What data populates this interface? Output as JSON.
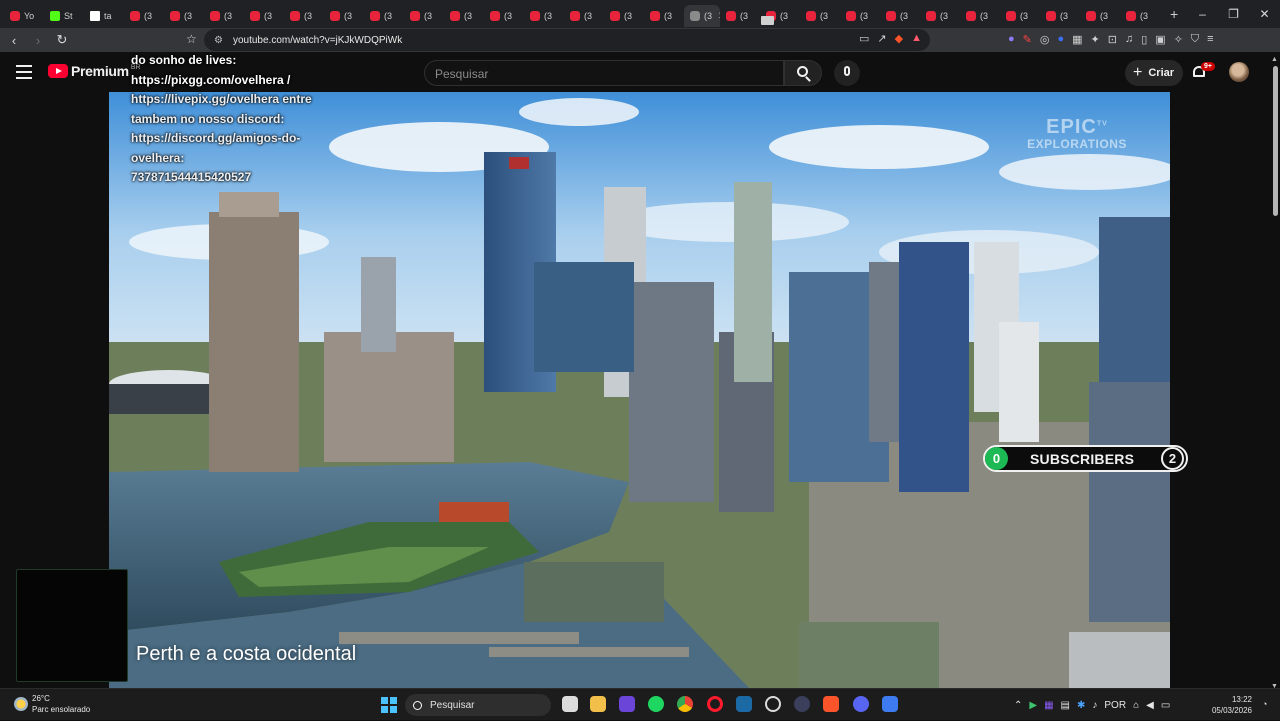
{
  "browser": {
    "tabs": [
      {
        "label": "Yo",
        "favicon": "youtube-icon"
      },
      {
        "label": "St",
        "favicon": "kick-icon"
      },
      {
        "label": "ta",
        "favicon": "gmail-icon"
      },
      {
        "label": "(3",
        "favicon": "youtube-icon"
      },
      {
        "label": "(3",
        "favicon": "youtube-icon"
      },
      {
        "label": "(3",
        "favicon": "youtube-icon"
      },
      {
        "label": "(3",
        "favicon": "youtube-icon"
      },
      {
        "label": "(3",
        "favicon": "youtube-icon"
      },
      {
        "label": "(3",
        "favicon": "youtube-icon"
      },
      {
        "label": "(3",
        "favicon": "youtube-icon"
      },
      {
        "label": "(3",
        "favicon": "youtube-icon"
      },
      {
        "label": "(3",
        "favicon": "youtube-icon"
      },
      {
        "label": "(3",
        "favicon": "youtube-icon"
      },
      {
        "label": "(3",
        "favicon": "youtube-icon"
      },
      {
        "label": "(3",
        "favicon": "youtube-icon"
      },
      {
        "label": "(3",
        "favicon": "youtube-icon"
      },
      {
        "label": "(3",
        "favicon": "youtube-icon"
      },
      {
        "label": "(3",
        "favicon": "gray-icon",
        "active": true
      },
      {
        "label": "(3",
        "favicon": "youtube-icon"
      },
      {
        "label": "(3",
        "favicon": "youtube-icon"
      },
      {
        "label": "(3",
        "favicon": "youtube-icon"
      },
      {
        "label": "(3",
        "favicon": "youtube-icon"
      },
      {
        "label": "(3",
        "favicon": "youtube-icon"
      },
      {
        "label": "(3",
        "favicon": "youtube-icon"
      },
      {
        "label": "(3",
        "favicon": "youtube-icon"
      },
      {
        "label": "(3",
        "favicon": "youtube-icon"
      },
      {
        "label": "(3",
        "favicon": "youtube-icon"
      },
      {
        "label": "(3",
        "favicon": "youtube-icon"
      },
      {
        "label": "(3",
        "favicon": "youtube-icon"
      }
    ],
    "new_tab": "+",
    "url": "youtube.com/watch?v=jKJkWDQPiWk",
    "win_controls": [
      "–",
      "❐",
      "✕"
    ]
  },
  "youtube": {
    "logo_text": "Premium",
    "logo_country": "BR",
    "search_placeholder": "Pesquisar",
    "create_label": "Criar",
    "notification_count": "9+"
  },
  "video": {
    "chat_overlay": [
      "do sonho de lives:",
      "https://pixgg.com/ovelhera /",
      "https://livepix.gg/ovelhera entre",
      "tambem no nosso discord:",
      "https://discord.gg/amigos-do-",
      "ovelhera:",
      "737871544415420527"
    ],
    "watermark_line1": "EPIC",
    "watermark_tv": "TV",
    "watermark_line2": "EXPLORATIONS",
    "subscribers_left": "0",
    "subscribers_label": "SUBSCRIBERS",
    "subscribers_right": "2",
    "caption": "Perth e a costa ocidental"
  },
  "taskbar": {
    "temperature": "26°C",
    "weather_desc": "Parc ensolarado",
    "search_label": "Pesquisar",
    "language": "POR",
    "time": "13:22",
    "date": "05/03/2026"
  },
  "colors": {
    "youtube_red": "#ff0033",
    "subscriber_green": "#1db954",
    "windows_blue": "#4cc2ff"
  }
}
